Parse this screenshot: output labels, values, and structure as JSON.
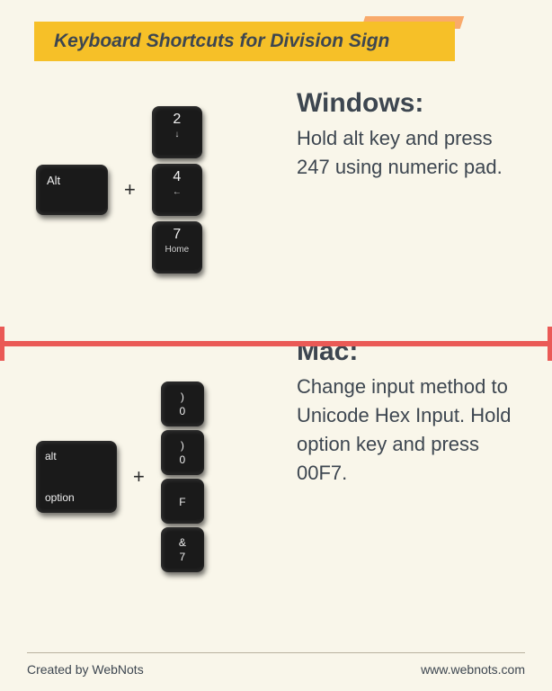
{
  "title": "Keyboard Shortcuts for Division Sign",
  "windows": {
    "heading": "Windows:",
    "body": "Hold alt key and press 247 using numeric pad.",
    "mod_key": "Alt",
    "plus": "+",
    "keys": [
      {
        "main": "2",
        "sub": "↓"
      },
      {
        "main": "4",
        "sub": "←"
      },
      {
        "main": "7",
        "sub": "Home"
      }
    ]
  },
  "mac": {
    "heading": "Mac:",
    "body": "Change input method to Unicode Hex Input. Hold option key and press 00F7.",
    "mod_key_top": "alt",
    "mod_key_bottom": "option",
    "plus": "+",
    "keys": [
      {
        "top": ")",
        "bot": "0"
      },
      {
        "top": ")",
        "bot": "0"
      },
      {
        "top": "",
        "bot": "F"
      },
      {
        "top": "&",
        "bot": "7"
      }
    ]
  },
  "footer": {
    "left": "Created by WebNots",
    "right": "www.webnots.com"
  }
}
